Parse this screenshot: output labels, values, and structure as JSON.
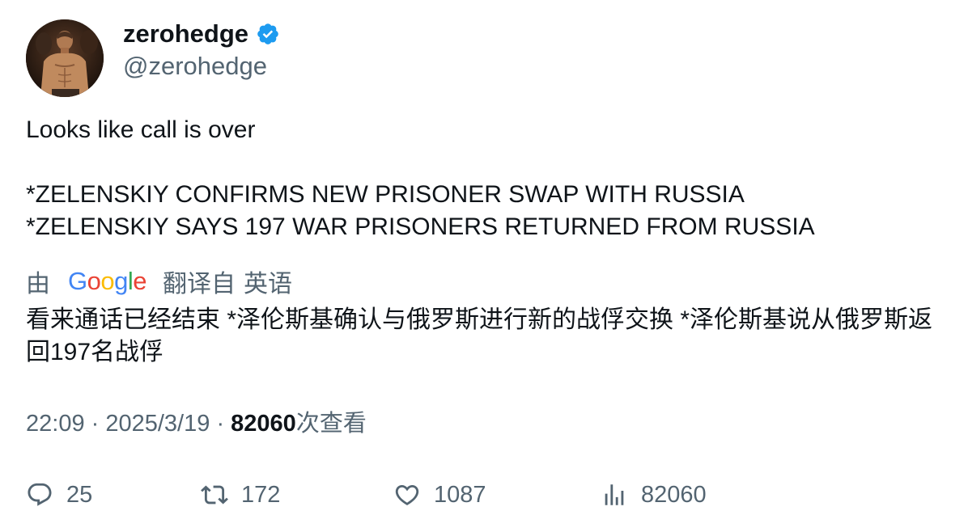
{
  "author": {
    "display_name": "zerohedge",
    "handle": "@zerohedge",
    "verified": true
  },
  "tweet": {
    "lines": [
      "Looks like call is over",
      "",
      "*ZELENSKIY CONFIRMS NEW PRISONER SWAP WITH RUSSIA",
      "*ZELENSKIY SAYS 197 WAR PRISONERS RETURNED FROM RUSSIA"
    ]
  },
  "translation": {
    "prefix": "由",
    "provider": "Google",
    "link_label": "翻译自",
    "source_language": "英语",
    "translated_text": "看来通话已经结束 *泽伦斯基确认与俄罗斯进行新的战俘交换 *泽伦斯基说从俄罗斯返回197名战俘"
  },
  "meta": {
    "time": "22:09",
    "separator": "·",
    "date": "2025/3/19",
    "views_count": "82060",
    "views_label": "次查看"
  },
  "actions": {
    "replies": "25",
    "retweets": "172",
    "likes": "1087",
    "views": "82060"
  },
  "colors": {
    "text_primary": "#0f1419",
    "text_secondary": "#536471",
    "verified_blue": "#1d9bf0",
    "google_blue": "#4285f4",
    "google_red": "#ea4335",
    "google_yellow": "#fbbc05",
    "google_green": "#34a853"
  }
}
